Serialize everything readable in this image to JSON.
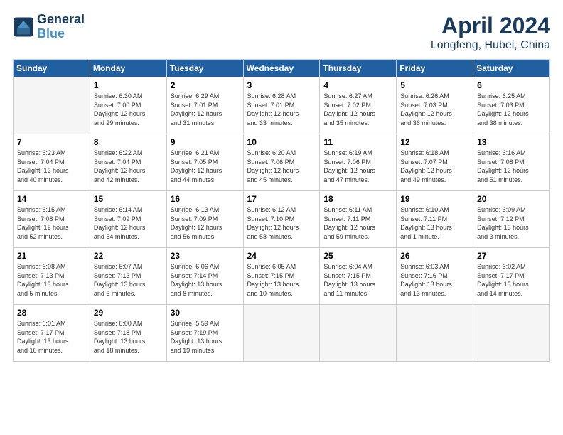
{
  "header": {
    "logo_line1": "General",
    "logo_line2": "Blue",
    "month": "April 2024",
    "location": "Longfeng, Hubei, China"
  },
  "weekdays": [
    "Sunday",
    "Monday",
    "Tuesday",
    "Wednesday",
    "Thursday",
    "Friday",
    "Saturday"
  ],
  "weeks": [
    [
      {
        "day": "",
        "info": ""
      },
      {
        "day": "1",
        "info": "Sunrise: 6:30 AM\nSunset: 7:00 PM\nDaylight: 12 hours\nand 29 minutes."
      },
      {
        "day": "2",
        "info": "Sunrise: 6:29 AM\nSunset: 7:01 PM\nDaylight: 12 hours\nand 31 minutes."
      },
      {
        "day": "3",
        "info": "Sunrise: 6:28 AM\nSunset: 7:01 PM\nDaylight: 12 hours\nand 33 minutes."
      },
      {
        "day": "4",
        "info": "Sunrise: 6:27 AM\nSunset: 7:02 PM\nDaylight: 12 hours\nand 35 minutes."
      },
      {
        "day": "5",
        "info": "Sunrise: 6:26 AM\nSunset: 7:03 PM\nDaylight: 12 hours\nand 36 minutes."
      },
      {
        "day": "6",
        "info": "Sunrise: 6:25 AM\nSunset: 7:03 PM\nDaylight: 12 hours\nand 38 minutes."
      }
    ],
    [
      {
        "day": "7",
        "info": "Sunrise: 6:23 AM\nSunset: 7:04 PM\nDaylight: 12 hours\nand 40 minutes."
      },
      {
        "day": "8",
        "info": "Sunrise: 6:22 AM\nSunset: 7:04 PM\nDaylight: 12 hours\nand 42 minutes."
      },
      {
        "day": "9",
        "info": "Sunrise: 6:21 AM\nSunset: 7:05 PM\nDaylight: 12 hours\nand 44 minutes."
      },
      {
        "day": "10",
        "info": "Sunrise: 6:20 AM\nSunset: 7:06 PM\nDaylight: 12 hours\nand 45 minutes."
      },
      {
        "day": "11",
        "info": "Sunrise: 6:19 AM\nSunset: 7:06 PM\nDaylight: 12 hours\nand 47 minutes."
      },
      {
        "day": "12",
        "info": "Sunrise: 6:18 AM\nSunset: 7:07 PM\nDaylight: 12 hours\nand 49 minutes."
      },
      {
        "day": "13",
        "info": "Sunrise: 6:16 AM\nSunset: 7:08 PM\nDaylight: 12 hours\nand 51 minutes."
      }
    ],
    [
      {
        "day": "14",
        "info": "Sunrise: 6:15 AM\nSunset: 7:08 PM\nDaylight: 12 hours\nand 52 minutes."
      },
      {
        "day": "15",
        "info": "Sunrise: 6:14 AM\nSunset: 7:09 PM\nDaylight: 12 hours\nand 54 minutes."
      },
      {
        "day": "16",
        "info": "Sunrise: 6:13 AM\nSunset: 7:09 PM\nDaylight: 12 hours\nand 56 minutes."
      },
      {
        "day": "17",
        "info": "Sunrise: 6:12 AM\nSunset: 7:10 PM\nDaylight: 12 hours\nand 58 minutes."
      },
      {
        "day": "18",
        "info": "Sunrise: 6:11 AM\nSunset: 7:11 PM\nDaylight: 12 hours\nand 59 minutes."
      },
      {
        "day": "19",
        "info": "Sunrise: 6:10 AM\nSunset: 7:11 PM\nDaylight: 13 hours\nand 1 minute."
      },
      {
        "day": "20",
        "info": "Sunrise: 6:09 AM\nSunset: 7:12 PM\nDaylight: 13 hours\nand 3 minutes."
      }
    ],
    [
      {
        "day": "21",
        "info": "Sunrise: 6:08 AM\nSunset: 7:13 PM\nDaylight: 13 hours\nand 5 minutes."
      },
      {
        "day": "22",
        "info": "Sunrise: 6:07 AM\nSunset: 7:13 PM\nDaylight: 13 hours\nand 6 minutes."
      },
      {
        "day": "23",
        "info": "Sunrise: 6:06 AM\nSunset: 7:14 PM\nDaylight: 13 hours\nand 8 minutes."
      },
      {
        "day": "24",
        "info": "Sunrise: 6:05 AM\nSunset: 7:15 PM\nDaylight: 13 hours\nand 10 minutes."
      },
      {
        "day": "25",
        "info": "Sunrise: 6:04 AM\nSunset: 7:15 PM\nDaylight: 13 hours\nand 11 minutes."
      },
      {
        "day": "26",
        "info": "Sunrise: 6:03 AM\nSunset: 7:16 PM\nDaylight: 13 hours\nand 13 minutes."
      },
      {
        "day": "27",
        "info": "Sunrise: 6:02 AM\nSunset: 7:17 PM\nDaylight: 13 hours\nand 14 minutes."
      }
    ],
    [
      {
        "day": "28",
        "info": "Sunrise: 6:01 AM\nSunset: 7:17 PM\nDaylight: 13 hours\nand 16 minutes."
      },
      {
        "day": "29",
        "info": "Sunrise: 6:00 AM\nSunset: 7:18 PM\nDaylight: 13 hours\nand 18 minutes."
      },
      {
        "day": "30",
        "info": "Sunrise: 5:59 AM\nSunset: 7:19 PM\nDaylight: 13 hours\nand 19 minutes."
      },
      {
        "day": "",
        "info": ""
      },
      {
        "day": "",
        "info": ""
      },
      {
        "day": "",
        "info": ""
      },
      {
        "day": "",
        "info": ""
      }
    ]
  ]
}
